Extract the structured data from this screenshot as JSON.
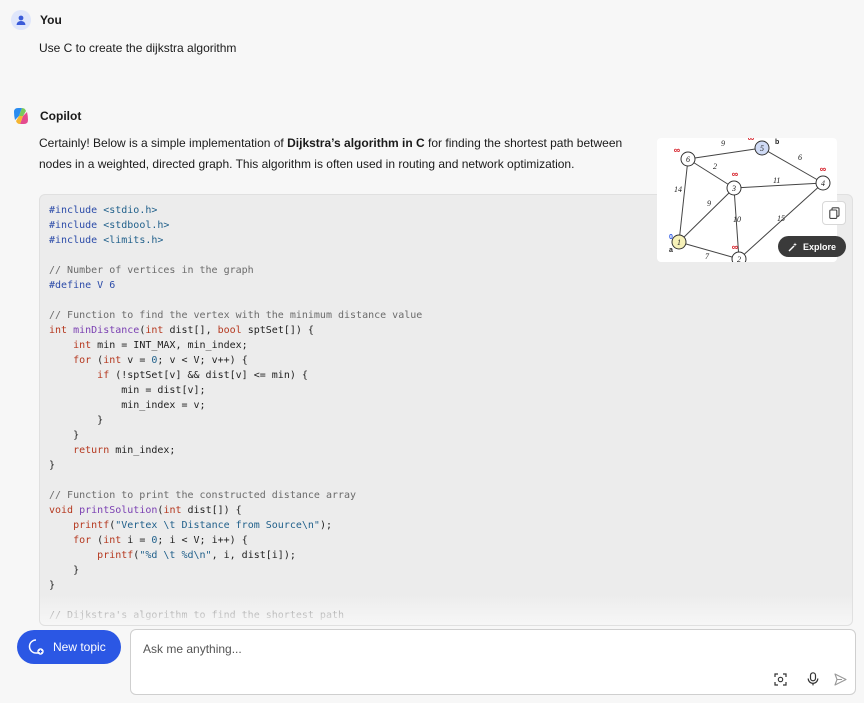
{
  "user": {
    "name": "You",
    "message": "Use C to create the dijkstra algorithm"
  },
  "copilot": {
    "name": "Copilot",
    "intro_before": "Certainly! Below is a simple implementation of ",
    "intro_bold": "Dijkstra’s algorithm in C",
    "intro_after": " for finding the shortest path between nodes in a weighted, directed graph. This algorithm is often used in routing and network optimization."
  },
  "code_lines": [
    [
      [
        "pp",
        "#include"
      ],
      [
        "",
        ""
      ],
      [
        "str",
        " <stdio.h>"
      ]
    ],
    [
      [
        "pp",
        "#include"
      ],
      [
        "str",
        " <stdbool.h>"
      ]
    ],
    [
      [
        "pp",
        "#include"
      ],
      [
        "str",
        " <limits.h>"
      ]
    ],
    [
      [
        "",
        ""
      ]
    ],
    [
      [
        "cm",
        "// Number of vertices in the graph"
      ]
    ],
    [
      [
        "pp",
        "#define"
      ],
      [
        "pp",
        " V 6"
      ]
    ],
    [
      [
        "",
        ""
      ]
    ],
    [
      [
        "cm",
        "// Function to find the vertex with the minimum distance value"
      ]
    ],
    [
      [
        "ty",
        "int"
      ],
      [
        "",
        " "
      ],
      [
        "fn",
        "minDistance"
      ],
      [
        "",
        "("
      ],
      [
        "ty",
        "int"
      ],
      [
        "",
        " dist[], "
      ],
      [
        "ty",
        "bool"
      ],
      [
        "",
        " sptSet[]) {"
      ]
    ],
    [
      [
        "",
        "    "
      ],
      [
        "ty",
        "int"
      ],
      [
        "",
        " min = INT_MAX, min_index;"
      ]
    ],
    [
      [
        "",
        "    "
      ],
      [
        "kw",
        "for"
      ],
      [
        "",
        " ("
      ],
      [
        "ty",
        "int"
      ],
      [
        "",
        " v = "
      ],
      [
        "num",
        "0"
      ],
      [
        "",
        "; v < V; v++) {"
      ]
    ],
    [
      [
        "",
        "        "
      ],
      [
        "kw",
        "if"
      ],
      [
        "",
        " (!sptSet[v] && dist[v] <= min) {"
      ]
    ],
    [
      [
        "",
        "            min = dist[v];"
      ]
    ],
    [
      [
        "",
        "            min_index = v;"
      ]
    ],
    [
      [
        "",
        "        }"
      ]
    ],
    [
      [
        "",
        "    }"
      ]
    ],
    [
      [
        "",
        "    "
      ],
      [
        "kw",
        "return"
      ],
      [
        "",
        " min_index;"
      ]
    ],
    [
      [
        "",
        "}"
      ]
    ],
    [
      [
        "",
        ""
      ]
    ],
    [
      [
        "cm",
        "// Function to print the constructed distance array"
      ]
    ],
    [
      [
        "ty",
        "void"
      ],
      [
        "",
        " "
      ],
      [
        "fn",
        "printSolution"
      ],
      [
        "",
        "("
      ],
      [
        "ty",
        "int"
      ],
      [
        "",
        " dist[]) {"
      ]
    ],
    [
      [
        "",
        "    "
      ],
      [
        "kw",
        "printf"
      ],
      [
        "",
        "("
      ],
      [
        "str",
        "\"Vertex \\t Distance from Source\\n\""
      ],
      [
        "",
        ");"
      ]
    ],
    [
      [
        "",
        "    "
      ],
      [
        "kw",
        "for"
      ],
      [
        "",
        " ("
      ],
      [
        "ty",
        "int"
      ],
      [
        "",
        " i = "
      ],
      [
        "num",
        "0"
      ],
      [
        "",
        "; i < V; i++) {"
      ]
    ],
    [
      [
        "",
        "        "
      ],
      [
        "kw",
        "printf"
      ],
      [
        "",
        "("
      ],
      [
        "str",
        "\"%d \\t %d\\n\""
      ],
      [
        "",
        ", i, dist[i]);"
      ]
    ],
    [
      [
        "",
        "    }"
      ]
    ],
    [
      [
        "",
        "}"
      ]
    ],
    [
      [
        "",
        ""
      ]
    ],
    [
      [
        "cm",
        "// Dijkstra's algorithm to find the shortest path"
      ]
    ]
  ],
  "graph": {
    "nodes": [
      {
        "id": "1",
        "label": "1",
        "tag": "a",
        "dist": "0"
      },
      {
        "id": "2",
        "label": "2",
        "dist": "∞"
      },
      {
        "id": "3",
        "label": "3",
        "dist": "∞"
      },
      {
        "id": "4",
        "label": "4",
        "dist": "∞"
      },
      {
        "id": "5",
        "label": "5",
        "tag": "b",
        "dist": "∞"
      },
      {
        "id": "6",
        "label": "6",
        "dist": "∞"
      }
    ],
    "edges": [
      {
        "from": "6",
        "to": "5",
        "w": "9"
      },
      {
        "from": "5",
        "to": "4",
        "w": "6"
      },
      {
        "from": "6",
        "to": "3",
        "w": "2"
      },
      {
        "from": "3",
        "to": "4",
        "w": "11"
      },
      {
        "from": "6",
        "to": "1",
        "w": "14"
      },
      {
        "from": "1",
        "to": "3",
        "w": "9"
      },
      {
        "from": "3",
        "to": "2",
        "w": "10"
      },
      {
        "from": "4",
        "to": "2",
        "w": "15"
      },
      {
        "from": "1",
        "to": "2",
        "w": "7"
      }
    ]
  },
  "explore_label": "Explore",
  "new_topic_label": "New topic",
  "input": {
    "placeholder": "Ask me anything..."
  },
  "colors": {
    "accent": "#2b57e4",
    "code_bg": "#ececec"
  }
}
